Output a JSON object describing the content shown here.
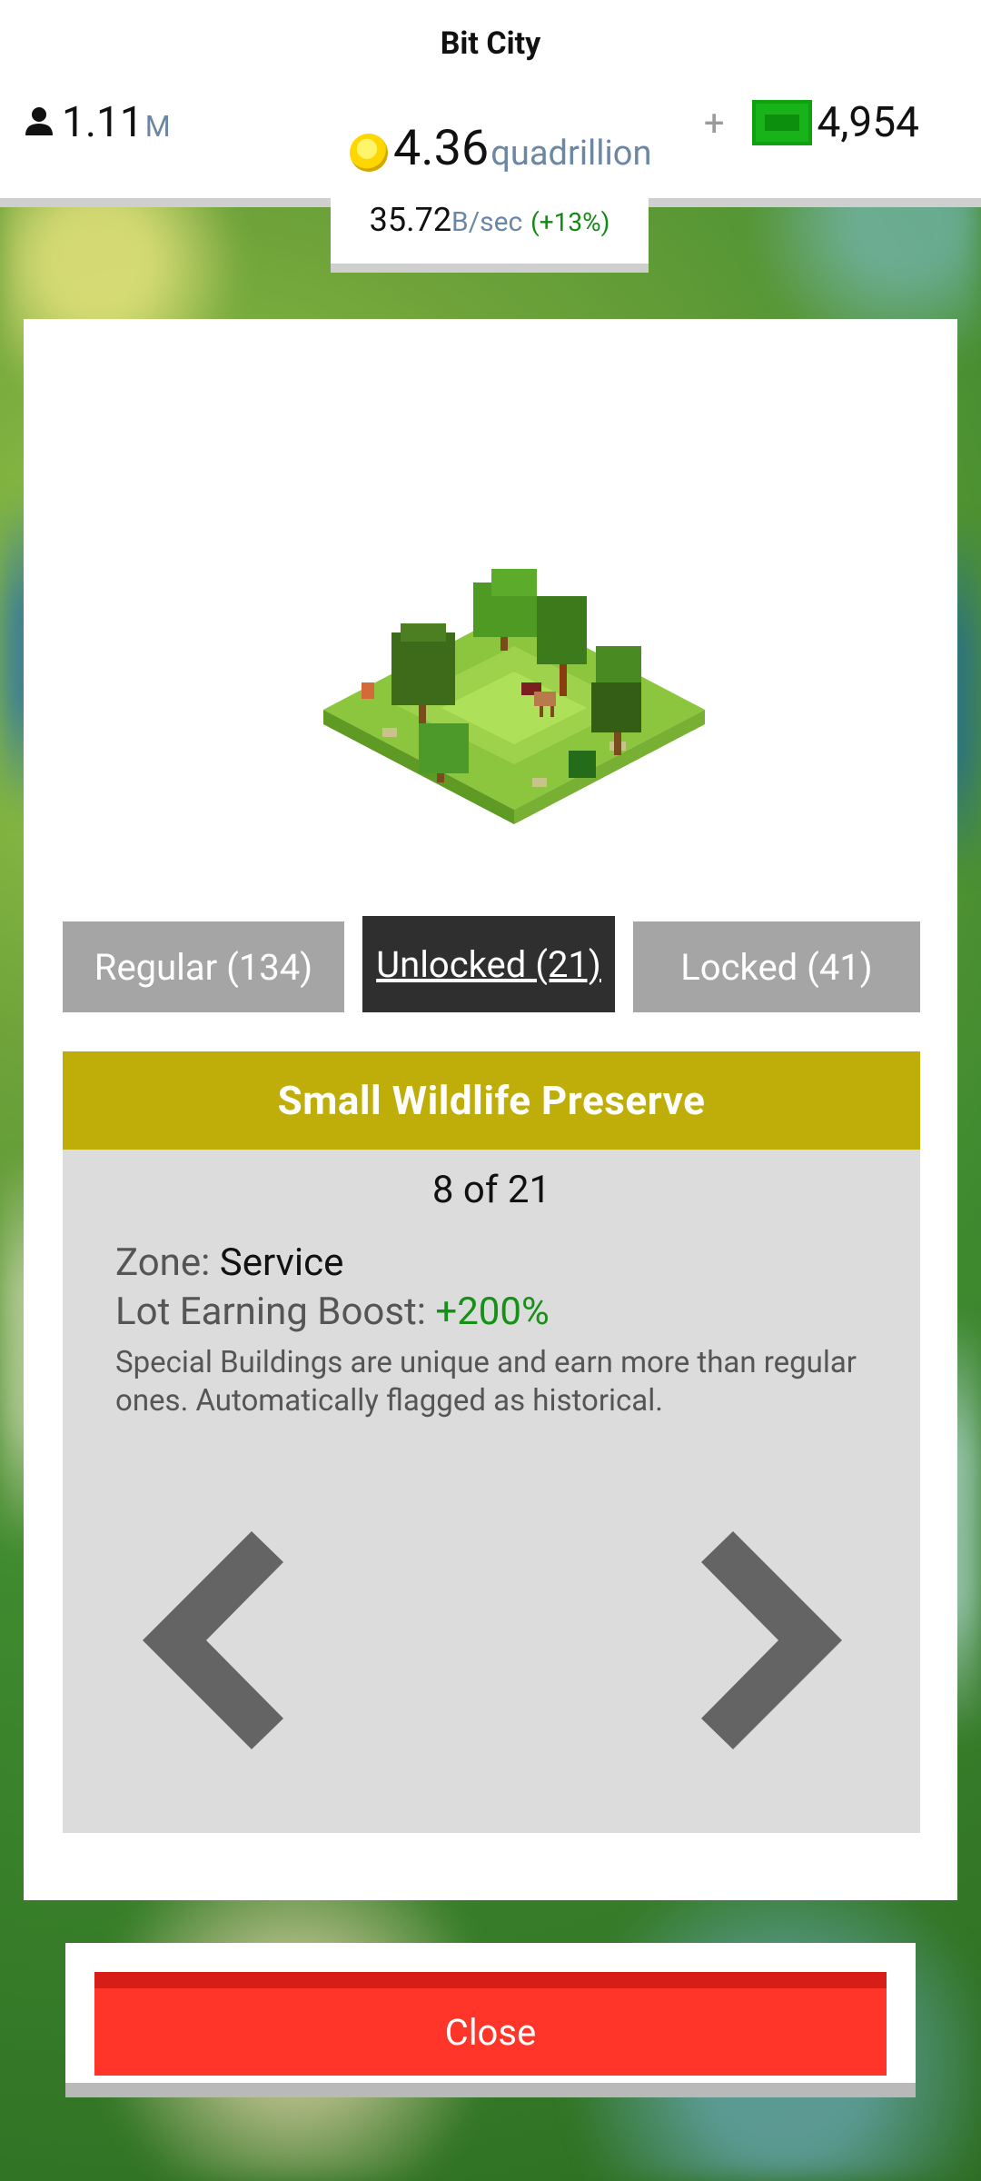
{
  "header": {
    "title": "Bit City",
    "population": {
      "value": "1.11",
      "unit": "M",
      "icon": "person-icon"
    },
    "coins": {
      "value": "4.36",
      "unit": "quadrillion",
      "icon": "coin-icon"
    },
    "cash": {
      "plus": "+",
      "value": "4,954",
      "icon": "cash-icon"
    },
    "rate": {
      "value": "35.72",
      "unit": "B/sec",
      "boost": "(+13%)"
    }
  },
  "tabs": [
    {
      "label": "Regular (134)",
      "active": false
    },
    {
      "label": "Unlocked (21)",
      "active": true
    },
    {
      "label": "Locked (41)",
      "active": false
    }
  ],
  "building": {
    "name": "Small Wildlife Preserve",
    "counter": "8 of 21",
    "zone_label": "Zone: ",
    "zone_value": "Service",
    "boost_label": "Lot Earning Boost: ",
    "boost_value": "+200%",
    "description": "Special Buildings are unique and earn more than regular ones. Automatically flagged as historical."
  },
  "nav": {
    "prev_icon": "chevron-left-icon",
    "next_icon": "chevron-right-icon"
  },
  "footer": {
    "close_label": "Close"
  },
  "colors": {
    "title_bar": "#bfae0a",
    "active_tab": "#2f2f2f",
    "inactive_tab": "#a5a5a5",
    "close_button": "#ff3529",
    "boost_green": "#169016"
  }
}
